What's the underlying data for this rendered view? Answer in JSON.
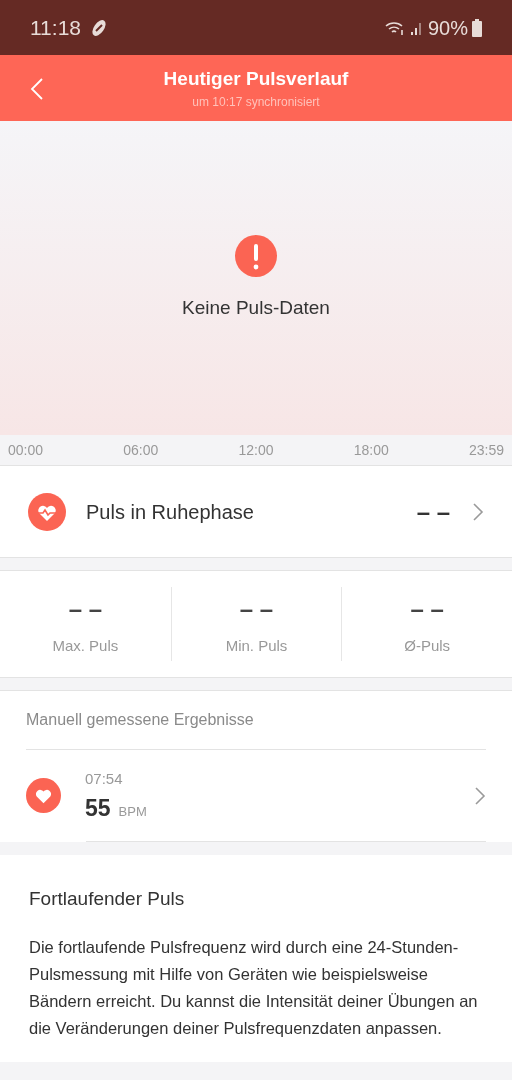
{
  "status_bar": {
    "time": "11:18",
    "battery": "90%"
  },
  "header": {
    "title": "Heutiger Pulsverlauf",
    "subtitle": "um 10:17 synchronisiert"
  },
  "chart": {
    "message": "Keine Puls-Daten",
    "x_labels": [
      "00:00",
      "06:00",
      "12:00",
      "18:00",
      "23:59"
    ]
  },
  "resting": {
    "label": "Puls in Ruhephase",
    "value": "– –"
  },
  "stats": [
    {
      "value": "– –",
      "label": "Max. Puls"
    },
    {
      "value": "– –",
      "label": "Min. Puls"
    },
    {
      "value": "– –",
      "label": "Ø-Puls"
    }
  ],
  "manual": {
    "title": "Manuell gemessene Ergebnisse",
    "entries": [
      {
        "time": "07:54",
        "value": "55",
        "unit": "BPM"
      }
    ]
  },
  "info": {
    "title": "Fortlaufender Puls",
    "text": "Die fortlaufende Pulsfrequenz wird durch eine 24-Stunden-Pulsmessung mit Hilfe von Geräten wie beispielsweise Bändern erreicht. Du kannst die Intensität deiner Übungen an die Veränderungen deiner Pulsfrequenzdaten anpassen."
  }
}
